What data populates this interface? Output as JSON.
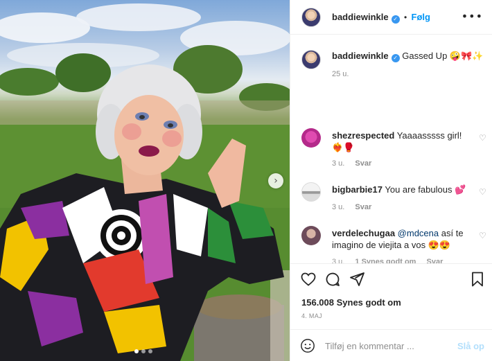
{
  "post": {
    "username": "baddiewinkle",
    "follow_label": "Følg",
    "header_separator": "•",
    "more_label": "•••",
    "caption": {
      "username": "baddiewinkle",
      "text": "Gassed Up 🤪🎀✨",
      "time": "25 u."
    },
    "comments": [
      {
        "username": "shezrespected",
        "text": "Yaaaasssss girl! ❤️‍🔥🥊",
        "time": "3 u.",
        "reply_label": "Svar"
      },
      {
        "username": "bigbarbie17",
        "text": "You are fabulous 💕",
        "time": "3 u.",
        "reply_label": "Svar"
      },
      {
        "username": "verdelechugaa",
        "mention": "@mdcena",
        "text": "así te imagino de viejita a vos 😍😍",
        "time": "3 u.",
        "likes_label": "1 Synes godt om",
        "reply_label": "Svar"
      }
    ],
    "likes": "156.008 Synes godt om",
    "date": "4. MAJ",
    "comment_placeholder": "Tilføj en kommentar ...",
    "post_label": "Slå op",
    "carousel_next": "›"
  },
  "colors": {
    "link_blue": "#0095f6",
    "verified_blue": "#3897f0",
    "muted_gray": "#8e8e8e",
    "post_disabled": "#b2dffc"
  },
  "icons": [
    "verified-badge-icon",
    "more-options-icon",
    "heart-icon",
    "comment-icon",
    "share-icon",
    "bookmark-icon",
    "emoji-icon",
    "chevron-right-icon"
  ]
}
